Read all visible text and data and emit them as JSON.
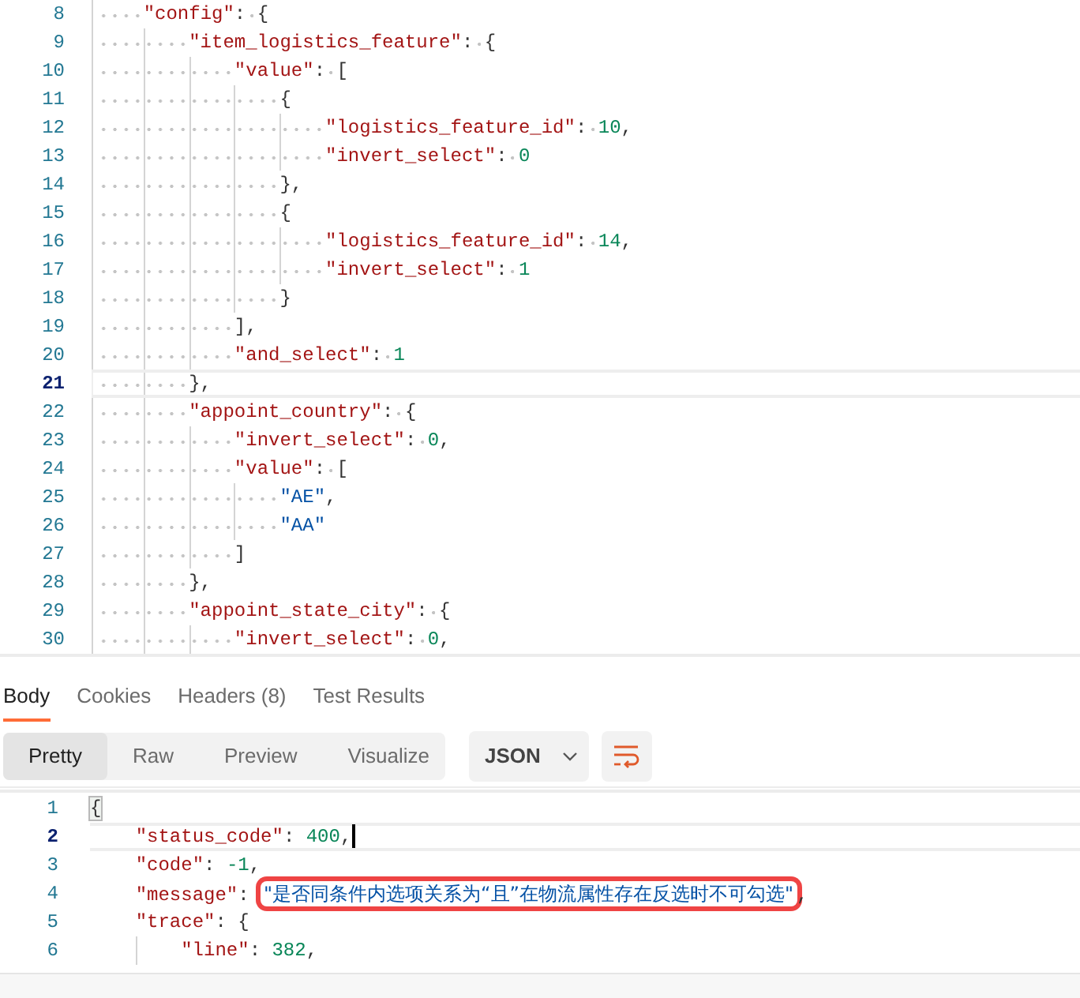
{
  "request_editor": {
    "lines": [
      {
        "number": "8",
        "text": "    \"config\": {",
        "current": false
      },
      {
        "number": "9",
        "text": "        \"item_logistics_feature\": {",
        "current": false
      },
      {
        "number": "10",
        "text": "            \"value\": [",
        "current": false
      },
      {
        "number": "11",
        "text": "                {",
        "current": false
      },
      {
        "number": "12",
        "text": "                    \"logistics_feature_id\": 10,",
        "current": false
      },
      {
        "number": "13",
        "text": "                    \"invert_select\": 0",
        "current": false
      },
      {
        "number": "14",
        "text": "                },",
        "current": false
      },
      {
        "number": "15",
        "text": "                {",
        "current": false
      },
      {
        "number": "16",
        "text": "                    \"logistics_feature_id\": 14,",
        "current": false
      },
      {
        "number": "17",
        "text": "                    \"invert_select\": 1",
        "current": false
      },
      {
        "number": "18",
        "text": "                }",
        "current": false
      },
      {
        "number": "19",
        "text": "            ],",
        "current": false
      },
      {
        "number": "20",
        "text": "            \"and_select\": 1",
        "current": false
      },
      {
        "number": "21",
        "text": "        },",
        "current": true
      },
      {
        "number": "22",
        "text": "        \"appoint_country\": {",
        "current": false
      },
      {
        "number": "23",
        "text": "            \"invert_select\": 0,",
        "current": false
      },
      {
        "number": "24",
        "text": "            \"value\": [",
        "current": false
      },
      {
        "number": "25",
        "text": "                \"AE\",",
        "current": false
      },
      {
        "number": "26",
        "text": "                \"AA\"",
        "current": false
      },
      {
        "number": "27",
        "text": "            ]",
        "current": false
      },
      {
        "number": "28",
        "text": "        },",
        "current": false
      },
      {
        "number": "29",
        "text": "        \"appoint_state_city\": {",
        "current": false
      },
      {
        "number": "30",
        "text": "            \"invert_select\": 0,",
        "current": false
      }
    ]
  },
  "response_tabs": [
    {
      "label": "Body",
      "selected": true
    },
    {
      "label": "Cookies",
      "selected": false
    },
    {
      "label": "Headers (8)",
      "selected": false
    },
    {
      "label": "Test Results",
      "selected": false
    }
  ],
  "view_modes": [
    {
      "label": "Pretty",
      "selected": true
    },
    {
      "label": "Raw",
      "selected": false
    },
    {
      "label": "Preview",
      "selected": false
    },
    {
      "label": "Visualize",
      "selected": false
    }
  ],
  "format_dropdown": {
    "value": "JSON"
  },
  "response_body": {
    "lines": [
      {
        "number": "1",
        "text": "{",
        "current": false,
        "bracket_match": true,
        "highlighted": false
      },
      {
        "number": "2",
        "text": "    \"status_code\": 400,",
        "current": true,
        "bracket_match": false,
        "highlighted": false
      },
      {
        "number": "3",
        "text": "    \"code\": -1,",
        "current": false,
        "bracket_match": false,
        "highlighted": false
      },
      {
        "number": "4",
        "text": "    \"message\": \"是否同条件内选项关系为“且”在物流属性存在反选时不可勾选\",",
        "current": false,
        "bracket_match": false,
        "highlighted": true
      },
      {
        "number": "5",
        "text": "    \"trace\": {",
        "current": false,
        "bracket_match": false,
        "highlighted": false
      },
      {
        "number": "6",
        "text": "        \"line\": 382,",
        "current": false,
        "bracket_match": false,
        "highlighted": false
      }
    ]
  }
}
